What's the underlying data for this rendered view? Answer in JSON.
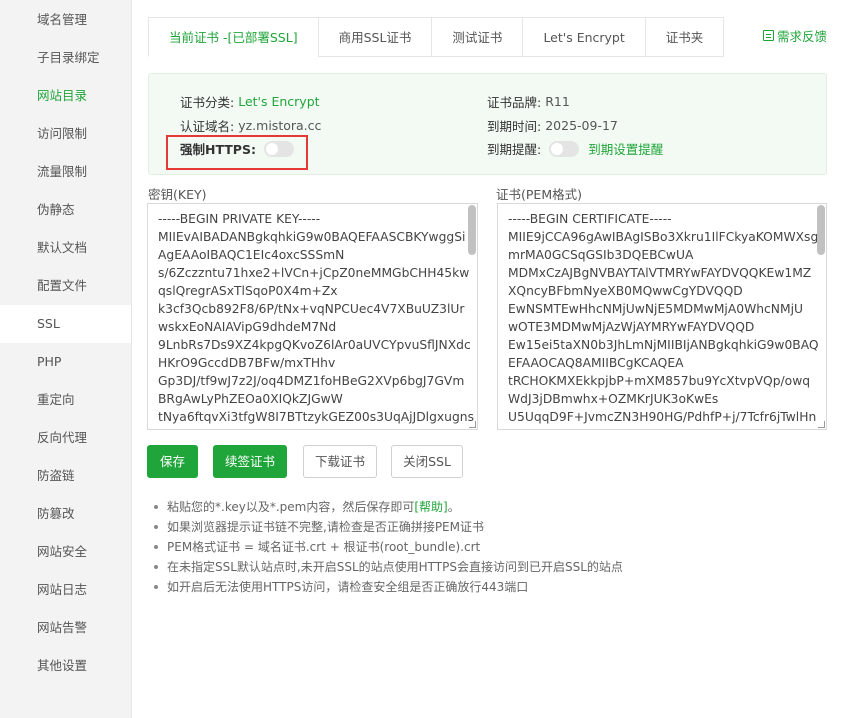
{
  "sidebar": {
    "items": [
      {
        "label": "域名管理"
      },
      {
        "label": "子目录绑定"
      },
      {
        "label": "网站目录"
      },
      {
        "label": "访问限制"
      },
      {
        "label": "流量限制"
      },
      {
        "label": "伪静态"
      },
      {
        "label": "默认文档"
      },
      {
        "label": "配置文件"
      },
      {
        "label": "SSL"
      },
      {
        "label": "PHP"
      },
      {
        "label": "重定向"
      },
      {
        "label": "反向代理"
      },
      {
        "label": "防盗链"
      },
      {
        "label": "防篡改"
      },
      {
        "label": "网站安全"
      },
      {
        "label": "网站日志"
      },
      {
        "label": "网站告警"
      },
      {
        "label": "其他设置"
      }
    ],
    "active": "SSL",
    "highlight": "网站目录"
  },
  "tabs": [
    {
      "label": "当前证书 -[已部署SSL]"
    },
    {
      "label": "商用SSL证书"
    },
    {
      "label": "测试证书"
    },
    {
      "label": "Let's Encrypt"
    },
    {
      "label": "证书夹"
    }
  ],
  "feedback": {
    "label": "需求反馈"
  },
  "info": {
    "category_label": "证书分类:",
    "category_value": "Let's Encrypt",
    "domain_label": "认证域名:",
    "domain_value": "yz.mistora.cc",
    "force_https_label": "强制HTTPS:",
    "force_https_enabled": false,
    "brand_label": "证书品牌:",
    "brand_value": "R11",
    "expire_label": "到期时间:",
    "expire_value": "2025-09-17",
    "remind_label": "到期提醒:",
    "remind_enabled": false,
    "remind_link": "到期设置提醒"
  },
  "key_pane": {
    "label": "密钥(KEY)",
    "lines": [
      "-----BEGIN PRIVATE KEY-----",
      "MIIEvAIBADANBgkqhkiG9w0BAQEFAASCBKYwggSi",
      "AgEAAoIBAQC1EIc4oxcSSSmN",
      "s/6Zczzntu71hxe2+lVCn+jCpZ0neMMGbCHH45kw",
      "qslQregrASxTlSqoP0X4m+Zx",
      "k3cf3Qcb892F8/6P/tNx+vqNPCUec4V7XBuUZ3lUr",
      "wskxEoNAIAVipG9dhdeM7Nd",
      "9LnbRs7Ds9XZ4kpgQKvoZ6lAr0aUVCYpvuSflJNXdc",
      "HKrO9GccdDB7BFw/mxTHhv",
      "Gp3DJ/tf9wJ7z2J/oq4DMZ1foHBeG2XVp6bgJ7GVm",
      "BRgAwLyPhZEOa0XIQkZJGwW",
      "tNya6ftqvXi3tfgW8I7BTtzykGEZ00s3UqAjJDlgxugns"
    ]
  },
  "cert_pane": {
    "label": "证书(PEM格式)",
    "lines": [
      "-----BEGIN CERTIFICATE-----",
      "MIIE9jCCA96gAwIBAgISBo3Xkru1IlFCkyaKOMWXsg",
      "mrMA0GCSqGSIb3DQEBCwUA",
      "MDMxCzAJBgNVBAYTAlVTMRYwFAYDVQQKEw1MZ",
      "XQncyBFbmNyeXB0MQwwCgYDVQQD",
      "EwNSMTEwHhcNMjUwNjE5MDMwMjA0WhcNMjU",
      "wOTE3MDMwMjAzWjAYMRYwFAYDVQQD",
      "Ew15ei5taXN0b3JhLmNjMIIBIjANBgkqhkiG9w0BAQ",
      "EFAAOCAQ8AMIIBCgKCAQEA",
      "tRCHOKMXEkkpjbP+mXM857bu9YcXtvpVQp/owq",
      "WdJ3jDBmwhx+OZMKrJUK3oKwEs",
      "U5UqqD9F+JvmcZN3H90HG/PdhfP+j/7Tcfr6jTwlHn"
    ]
  },
  "buttons": {
    "save": "保存",
    "renew": "续签证书",
    "download": "下载证书",
    "close": "关闭SSL"
  },
  "tips": {
    "tip1_prefix": "粘贴您的*.key以及*.pem内容，然后保存即可",
    "tip1_link": "[帮助]",
    "tip1_suffix": "。",
    "tip2": "如果浏览器提示证书链不完整,请检查是否正确拼接PEM证书",
    "tip3": "PEM格式证书 = 域名证书.crt + 根证书(root_bundle).crt",
    "tip4": "在未指定SSL默认站点时,未开启SSL的站点使用HTTPS会直接访问到已开启SSL的站点",
    "tip5": "如开启后无法使用HTTPS访问，请检查安全组是否正确放行443端口"
  }
}
